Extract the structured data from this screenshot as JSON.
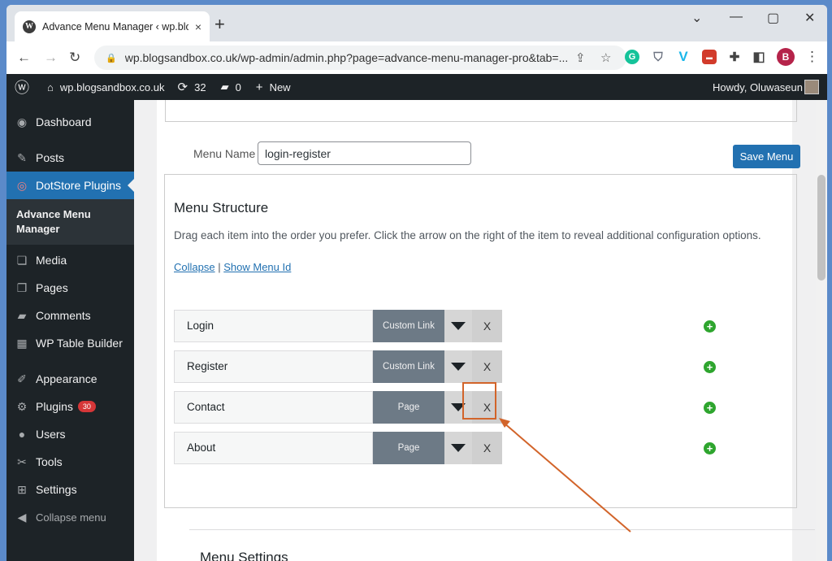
{
  "browser": {
    "tab_title": "Advance Menu Manager ‹ wp.blo",
    "tab_close": "×",
    "new_tab": "+",
    "url": "wp.blogsandbox.co.uk/wp-admin/admin.php?page=advance-menu-manager-pro&tab=...",
    "window_controls": [
      "⌄",
      "—",
      "▢",
      "✕"
    ],
    "extensions": [
      {
        "name": "grammarly",
        "glyph": "G",
        "color": "#15c39a"
      },
      {
        "name": "shield",
        "glyph": "⛉",
        "color": "#6b7280"
      },
      {
        "name": "vimeo",
        "glyph": "V",
        "color": "#1ab7ea"
      },
      {
        "name": "recorder",
        "glyph": "▬",
        "color": "#d23b2b"
      },
      {
        "name": "puzzle",
        "glyph": "✚",
        "color": "#444"
      },
      {
        "name": "sidepanel",
        "glyph": "◧",
        "color": "#444"
      }
    ],
    "profile_initial": "B"
  },
  "adminbar": {
    "site": "wp.blogsandbox.co.uk",
    "updates": "32",
    "comments": "0",
    "new_label": "New",
    "howdy": "Howdy, Oluwaseun"
  },
  "sidebar": {
    "items": [
      {
        "label": "Dashboard",
        "icon": "dashboard-icon",
        "glyph": "◉"
      },
      {
        "label": "Posts",
        "icon": "pin-icon",
        "glyph": "✎"
      },
      {
        "label": "DotStore Plugins",
        "icon": "dotstore-icon",
        "glyph": "◎"
      },
      {
        "label": "Advance Menu Manager"
      },
      {
        "label": "Media",
        "icon": "media-icon",
        "glyph": "❏"
      },
      {
        "label": "Pages",
        "icon": "pages-icon",
        "glyph": "❐"
      },
      {
        "label": "Comments",
        "icon": "comments-icon",
        "glyph": "▰"
      },
      {
        "label": "WP Table Builder",
        "icon": "table-icon",
        "glyph": "▦"
      },
      {
        "label": "Appearance",
        "icon": "appearance-icon",
        "glyph": "✐"
      },
      {
        "label": "Plugins",
        "icon": "plugins-icon",
        "glyph": "⚙",
        "badge": "30"
      },
      {
        "label": "Users",
        "icon": "users-icon",
        "glyph": "●"
      },
      {
        "label": "Tools",
        "icon": "tools-icon",
        "glyph": "✂"
      },
      {
        "label": "Settings",
        "icon": "settings-icon",
        "glyph": "⊞"
      },
      {
        "label": "Collapse menu",
        "icon": "collapse-icon",
        "glyph": "◀"
      }
    ]
  },
  "main": {
    "menu_name_label": "Menu Name",
    "menu_name_value": "login-register",
    "save_label": "Save Menu",
    "structure_title": "Menu Structure",
    "structure_desc": "Drag each item into the order you prefer. Click the arrow on the right of the item to reveal additional configuration options.",
    "collapse_link": "Collapse",
    "link_sep": "|",
    "show_id_link": "Show Menu Id",
    "delete_glyph": "X",
    "menu_items": [
      {
        "name": "Login",
        "type": "Custom Link"
      },
      {
        "name": "Register",
        "type": "Custom Link"
      },
      {
        "name": "Contact",
        "type": "Page"
      },
      {
        "name": "About",
        "type": "Page"
      }
    ],
    "settings_title": "Menu Settings"
  },
  "annotation": {
    "arrow_color": "#d2642a"
  }
}
